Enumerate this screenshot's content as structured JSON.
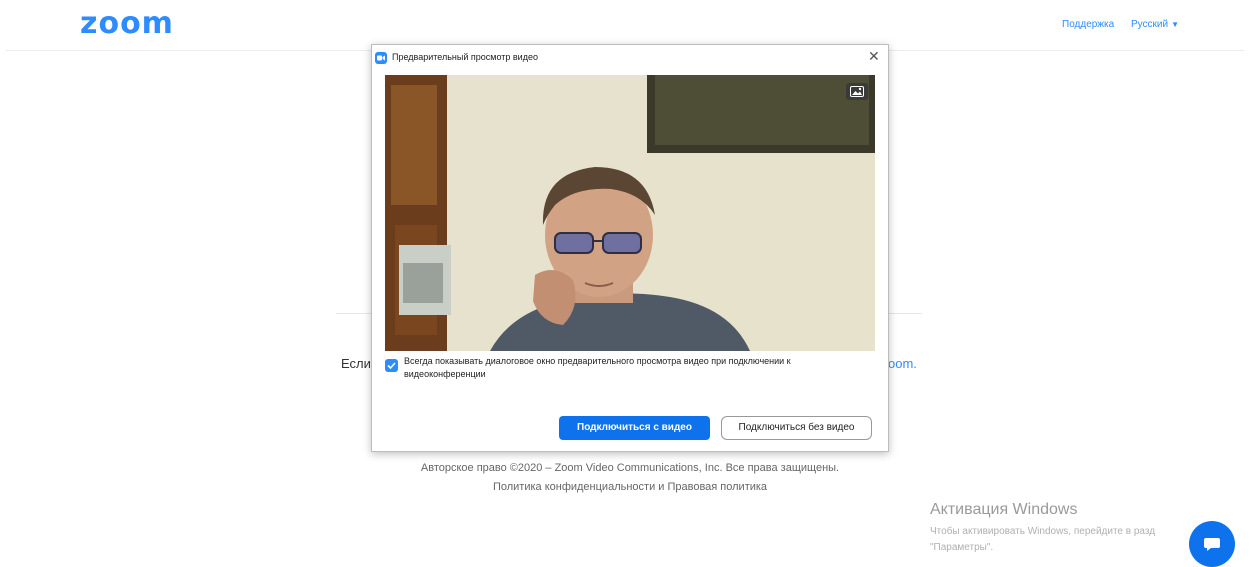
{
  "header": {
    "logo": "zoom",
    "support_link": "Поддержка",
    "language": "Русский"
  },
  "page": {
    "bg_text_left": "Если",
    "bg_text_right": "oom.",
    "footer_copyright": "Авторское право ©2020 – Zoom Video Communications, Inc. Все права защищены.",
    "footer_links": "Политика конфиденциальности и Правовая политика"
  },
  "dialog": {
    "title": "Предварительный просмотр видео",
    "checkbox_checked": true,
    "checkbox_label": "Всегда показывать диалоговое окно предварительного просмотра видео при подключении к видеоконференции",
    "join_with_video_button": "Подключиться с видео",
    "join_without_video_button": "Подключиться без видео"
  },
  "watermark": {
    "title": "Активация Windows",
    "line1": "Чтобы активировать Windows, перейдите в разд",
    "line2": "\"Параметры\"."
  },
  "colors": {
    "brand": "#2d8cff",
    "primary_button": "#0e72ed"
  }
}
